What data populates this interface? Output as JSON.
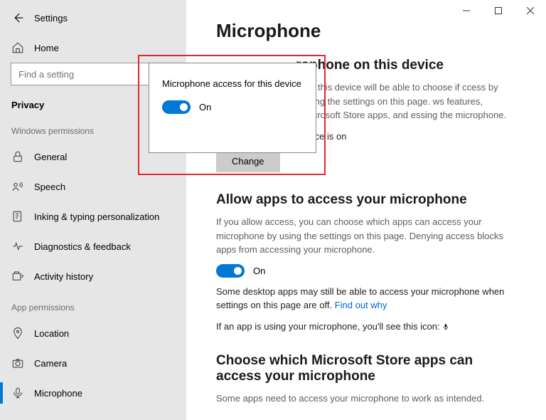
{
  "window": {
    "title": "Settings",
    "search_placeholder": "Find a setting"
  },
  "sidebar": {
    "home": "Home",
    "privacy": "Privacy",
    "group_windows": "Windows permissions",
    "group_app": "App permissions",
    "items_win": [
      {
        "icon": "lock",
        "label": "General"
      },
      {
        "icon": "speech",
        "label": "Speech"
      },
      {
        "icon": "inking",
        "label": "Inking & typing personalization"
      },
      {
        "icon": "diagnostics",
        "label": "Diagnostics & feedback"
      },
      {
        "icon": "activity",
        "label": "Activity history"
      }
    ],
    "items_app": [
      {
        "icon": "location",
        "label": "Location"
      },
      {
        "icon": "camera",
        "label": "Camera"
      },
      {
        "icon": "microphone",
        "label": "Microphone",
        "active": true
      }
    ]
  },
  "main": {
    "title": "Microphone",
    "section1": {
      "heading_partial": "rophone on this device",
      "body_partial": "ing this device will be able to choose if ccess by using the settings on this page. ws features, Microsoft Store apps, and essing the microphone.",
      "status_partial": "evice is on",
      "change_btn": "Change"
    },
    "section2": {
      "heading": "Allow apps to access your microphone",
      "body": "If you allow access, you can choose which apps can access your microphone by using the settings on this page. Denying access blocks apps from accessing your microphone.",
      "toggle_label": "On",
      "note": "Some desktop apps may still be able to access your microphone when settings on this page are off. ",
      "link": "Find out why",
      "icon_note": "If an app is using your microphone, you'll see this icon: "
    },
    "section3": {
      "heading": "Choose which Microsoft Store apps can access your microphone",
      "body": "Some apps need to access your microphone to work as intended."
    }
  },
  "flyout": {
    "title": "Microphone access for this device",
    "toggle_label": "On"
  }
}
